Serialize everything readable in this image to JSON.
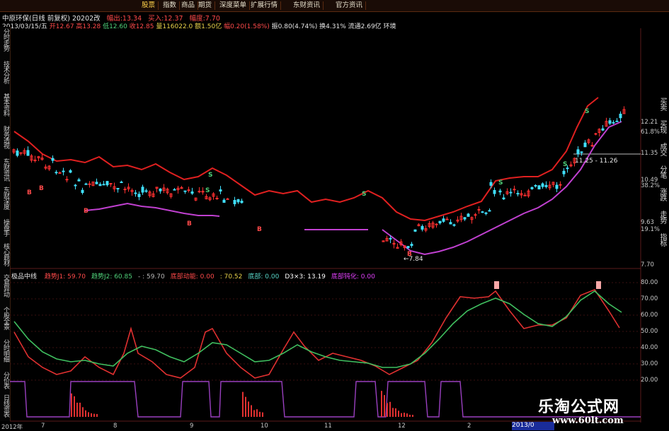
{
  "menu": {
    "items": [
      "股票",
      "指数",
      "商品",
      "期货",
      "深度菜单",
      "扩展行情",
      "东财资讯",
      "官方资讯"
    ],
    "active_index": 0
  },
  "stock": {
    "title": "中原环保(日线 前复权) 20202改",
    "chg_label": "幅出:",
    "chg_value": "13.34",
    "buy_label": "买入:",
    "buy_value": "12.37",
    "range_label": "幅度:",
    "range_value": "7.70"
  },
  "quote": {
    "date": "2013/03/15/五",
    "open": "开12.67",
    "high": "高13.28",
    "low": "低12.60",
    "close": "收12.85",
    "volume": "量116022.0",
    "amount": "额1.50亿",
    "change": "幅0.20(1.58%)",
    "amplitude": "振0.80(4.74%)",
    "turnover": "换4.31%",
    "float": "流通2.69亿",
    "env": "环境"
  },
  "sidebar_left": [
    "分时走势",
    "技术分析",
    "基本资料",
    "财务透视",
    "东财资讯",
    "东财深度",
    "操盘手",
    "核心题材",
    "交易异动",
    "个股全景",
    "分时明细",
    "分价表",
    "日线资表"
  ],
  "sidebar_right": [
    "买卖",
    "买现",
    "成交",
    "分笔",
    "涨跌",
    "走势",
    "指标"
  ],
  "price_axis": [
    "12.21",
    "61.8%",
    "11.35",
    "10.49",
    "38.2%",
    "9.63",
    "19.1%",
    "7.70"
  ],
  "annotations": {
    "high_range": "11.25 - 11.26",
    "low_price": "7.84",
    "s_labels": [
      "S",
      "S",
      "S",
      "S",
      "S",
      "S"
    ],
    "b_labels": [
      "B",
      "B",
      "B",
      "B",
      "B",
      "B"
    ]
  },
  "indicator": {
    "name": "极品中线",
    "items": [
      {
        "text": "趋势J1: 59.70",
        "color": "#ff4a4a"
      },
      {
        "text": "趋势J2: 60.85",
        "color": "#4fd27a"
      },
      {
        "text": "- : 59.70",
        "color": "#bbbbbb"
      },
      {
        "text": "底部动能: 0.00",
        "color": "#ff4a4a"
      },
      {
        "text": ": 70.52",
        "color": "#e8d24a"
      },
      {
        "text": "底部: 0.00",
        "color": "#58d6c8"
      },
      {
        "text": "D3×3: 13.19",
        "color": "#ffffff"
      },
      {
        "text": "底部钝化: 0.00",
        "color": "#e040fb"
      }
    ]
  },
  "indicator_axis": [
    "80.00",
    "70.00",
    "60.00",
    "50.00",
    "40.00",
    "30.00",
    "20.00"
  ],
  "bottom_axis": [
    "2012年",
    "7",
    "8",
    "9",
    "10",
    "11",
    "12",
    "2"
  ],
  "current_date": "2013/0",
  "watermark": {
    "title": "乐淘公式网",
    "url": "www.60lt.com"
  },
  "colors": {
    "bull": "#ff3030",
    "bear": "#40e0ff",
    "upper_band": "#e02020",
    "lower_band": "#c040d0",
    "j1": "#e03030",
    "j2": "#40c060"
  }
}
